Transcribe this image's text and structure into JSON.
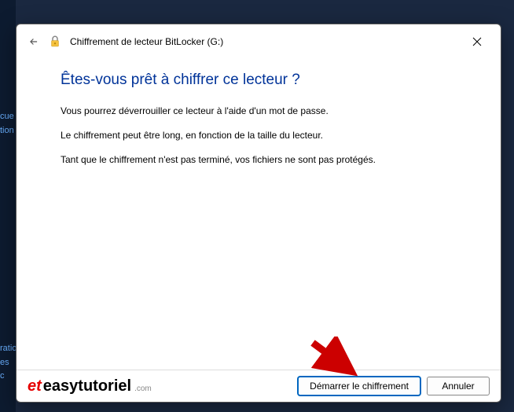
{
  "background": {
    "partial1": "cue",
    "partial2": "tion",
    "partial3": "ratio",
    "partial4": "es c"
  },
  "dialog": {
    "title": "Chiffrement de lecteur BitLocker (G:)",
    "heading": "Êtes-vous prêt à chiffrer ce lecteur ?",
    "line1": "Vous pourrez déverrouiller ce lecteur à l'aide d'un mot de passe.",
    "line2": "Le chiffrement peut être long, en fonction de la taille du lecteur.",
    "line3": "Tant que le chiffrement n'est pas terminé, vos fichiers ne sont pas protégés.",
    "buttons": {
      "start": "Démarrer le chiffrement",
      "cancel": "Annuler"
    }
  },
  "branding": {
    "prefix": "et",
    "name": "easytutoriel",
    "suffix": ".com"
  }
}
